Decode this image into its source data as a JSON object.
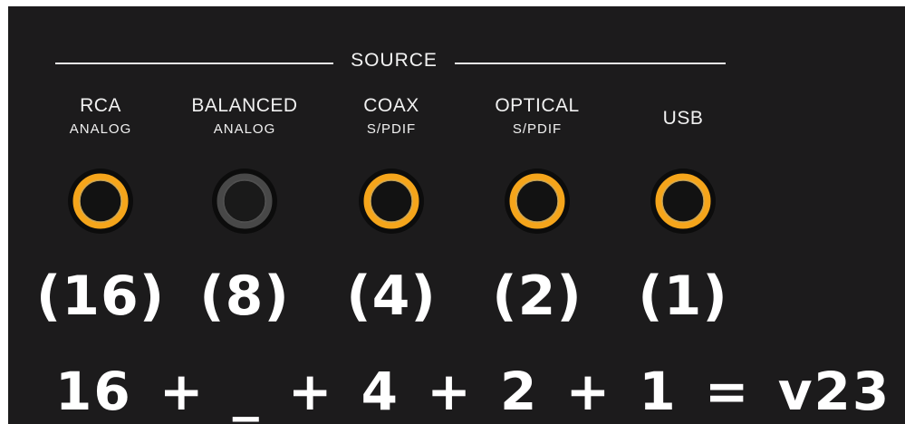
{
  "header": {
    "title": "SOURCE"
  },
  "inputs": [
    {
      "id": "rca",
      "line1": "RCA",
      "line2": "ANALOG",
      "weight": "(16)",
      "active": true
    },
    {
      "id": "balanced",
      "line1": "BALANCED",
      "line2": "ANALOG",
      "weight": "(8)",
      "active": false
    },
    {
      "id": "coax",
      "line1": "COAX",
      "line2": "S/PDIF",
      "weight": "(4)",
      "active": true
    },
    {
      "id": "optical",
      "line1": "OPTICAL",
      "line2": "S/PDIF",
      "weight": "(2)",
      "active": true
    },
    {
      "id": "usb",
      "line1": "USB",
      "line2": "",
      "weight": "(1)",
      "active": true
    }
  ],
  "formula": {
    "text": "16 + _ + 4 + 2 + 1 = v23"
  },
  "colors": {
    "panel_bg": "#1c1b1c",
    "text": "#f1f1f1",
    "led_active_ring": "#f5a51b",
    "led_inactive_ring": "#4a4a4a",
    "led_center": "#111111"
  }
}
